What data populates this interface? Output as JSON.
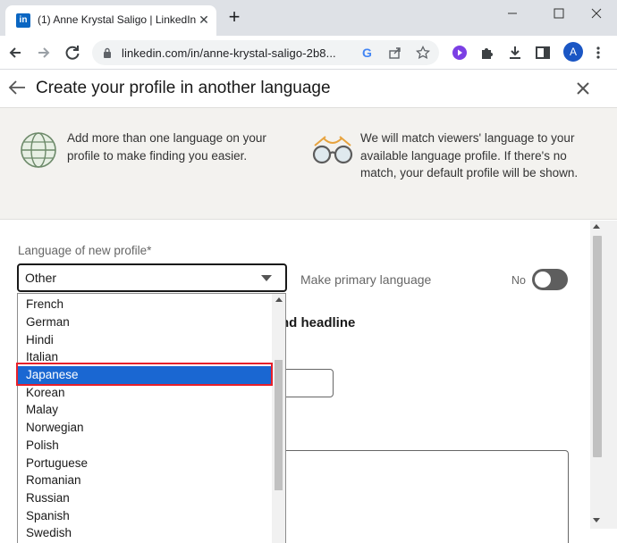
{
  "browser": {
    "tab_title": "(1) Anne Krystal Saligo | LinkedIn",
    "favicon_text": "in",
    "url": "linkedin.com/in/anne-krystal-saligo-2b8...",
    "avatar_letter": "A"
  },
  "modal": {
    "title": "Create your profile in another language",
    "info_left": "Add more than one language on your profile to make finding you easier.",
    "info_right": "We will match viewers' language to your available language profile. If there's no match, your default profile will be shown."
  },
  "form": {
    "language_label": "Language of new profile*",
    "selected_language": "Other",
    "primary_label": "Make primary language",
    "toggle_state": "No",
    "section_heading_partial": "nd headline"
  },
  "dropdown": {
    "options": [
      "French",
      "German",
      "Hindi",
      "Italian",
      "Japanese",
      "Korean",
      "Malay",
      "Norwegian",
      "Polish",
      "Portuguese",
      "Romanian",
      "Russian",
      "Spanish",
      "Swedish"
    ],
    "highlighted": "Japanese"
  },
  "colors": {
    "linkedin_blue": "#0a66c2",
    "selection_blue": "#1a67d2",
    "annotation_red": "#e8202a"
  }
}
